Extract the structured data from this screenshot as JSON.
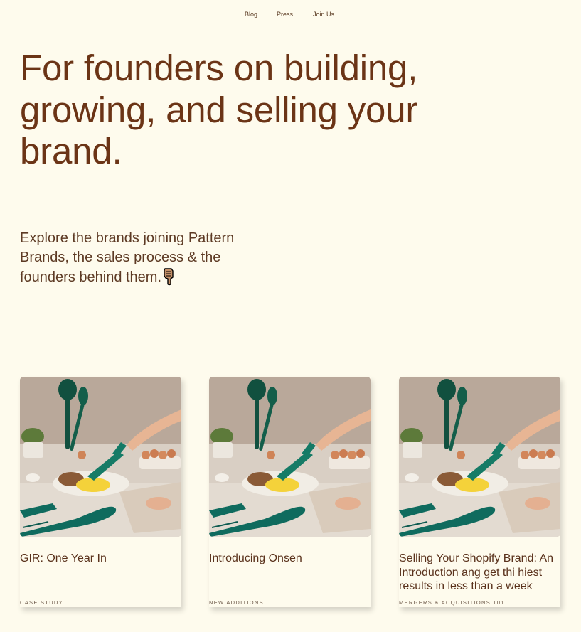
{
  "nav": {
    "items": [
      {
        "label": "Blog"
      },
      {
        "label": "Press"
      },
      {
        "label": "Join Us"
      }
    ]
  },
  "hero": {
    "title": "For founders on building, growing, and selling your brand.",
    "subtitle": "Explore the brands joining Pattern Brands, the sales process & the founders behind them.",
    "pointer_icon": "pointing-down-hand-icon"
  },
  "cards": [
    {
      "title": "GIR: One Year In",
      "tag": "CASE STUDY",
      "image": "kitchen-utensils-photo"
    },
    {
      "title": "Introducing Onsen",
      "tag": "NEW ADDITIONS",
      "image": "kitchen-utensils-photo"
    },
    {
      "title": "Selling Your Shopify Brand: An Introduction ang get thi hiest results in less than a week",
      "tag": "MERGERS & ACQUISITIONS 101",
      "image": "kitchen-utensils-photo"
    }
  ],
  "colors": {
    "background": "#fefbed",
    "heading": "#6b3416",
    "utensil_green": "#0f6b5e"
  }
}
